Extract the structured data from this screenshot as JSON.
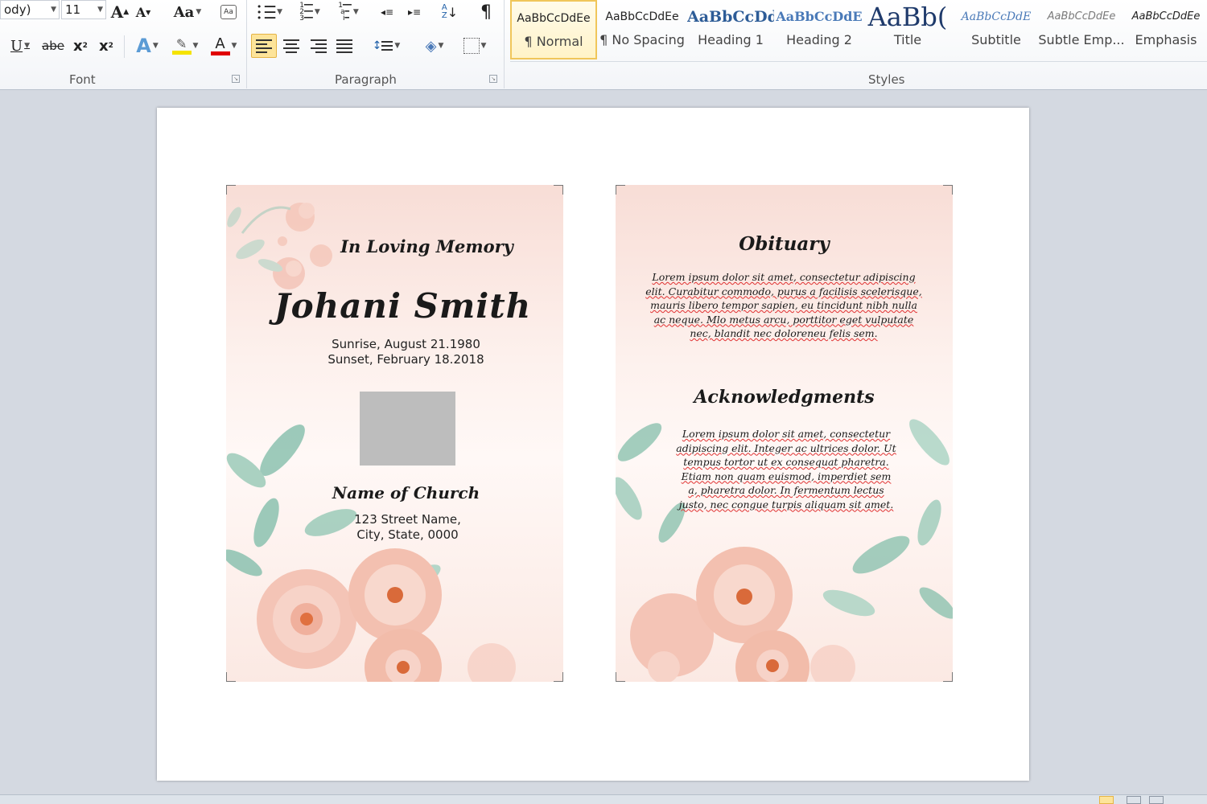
{
  "ribbon": {
    "font": {
      "font_name": "ody)",
      "font_size": "11",
      "group_label": "Font",
      "grow_label": "A",
      "shrink_label": "A",
      "change_case_label": "Aa",
      "underline_label": "U",
      "strike_label": "abe",
      "subscript_label": "x",
      "superscript_label": "x",
      "text_effects_label": "A",
      "font_color_label": "A",
      "colors": {
        "highlight": "#f5e300",
        "font_color": "#e00000"
      }
    },
    "paragraph": {
      "group_label": "Paragraph",
      "show_marks_label": "¶"
    },
    "styles": {
      "group_label": "Styles",
      "items": [
        {
          "sample": "AaBbCcDdEe",
          "name": "¶ Normal"
        },
        {
          "sample": "AaBbCcDdEe",
          "name": "¶ No Spacing"
        },
        {
          "sample": "AaBbCcDd",
          "name": "Heading 1"
        },
        {
          "sample": "AaBbCcDdE",
          "name": "Heading 2"
        },
        {
          "sample": "AaBb(",
          "name": "Title"
        },
        {
          "sample": "AaBbCcDdE",
          "name": "Subtitle"
        },
        {
          "sample": "AaBbCcDdEe",
          "name": "Subtle Emp..."
        },
        {
          "sample": "AaBbCcDdEe",
          "name": "Emphasis"
        }
      ],
      "colors": {
        "heading": "#2d5c97",
        "subtitle": "#4a7ab8",
        "subtle": "#7a7a7a"
      }
    }
  },
  "document": {
    "left_card": {
      "heading": "In Loving Memory",
      "name": "Johani Smith",
      "sunrise": "Sunrise, August 21.1980",
      "sunset": "Sunset, February 18.2018",
      "church": "Name of Church",
      "address_line1": "123 Street Name,",
      "address_line2": "City, State, 0000"
    },
    "right_card": {
      "obituary_title": "Obituary",
      "obituary_text": "Lorem ipsum dolor sit amet, consectetur adipiscing elit. Curabitur commodo, purus a facilisis scelerisque, mauris libero tempor sapien, eu tincidunt nibh nulla ac neque. Mlo metus arcu, porttitor eget vulputate nec, blandit nec doloreneu felis sem.",
      "ack_title": "Acknowledgments",
      "ack_text": "Lorem ipsum dolor sit amet, consectetur adipiscing elit. Integer ac ultrices dolor. Ut tempus tortor ut ex consequat pharetra. Etiam non quam euismod, imperdiet sem a, pharetra dolor. In fermentum lectus justo, nec congue turpis aliquam sit amet."
    },
    "colors": {
      "rose": "#f2b9a8",
      "leaf": "#8cc2b0",
      "card_bg": "#fbe6e0"
    }
  }
}
